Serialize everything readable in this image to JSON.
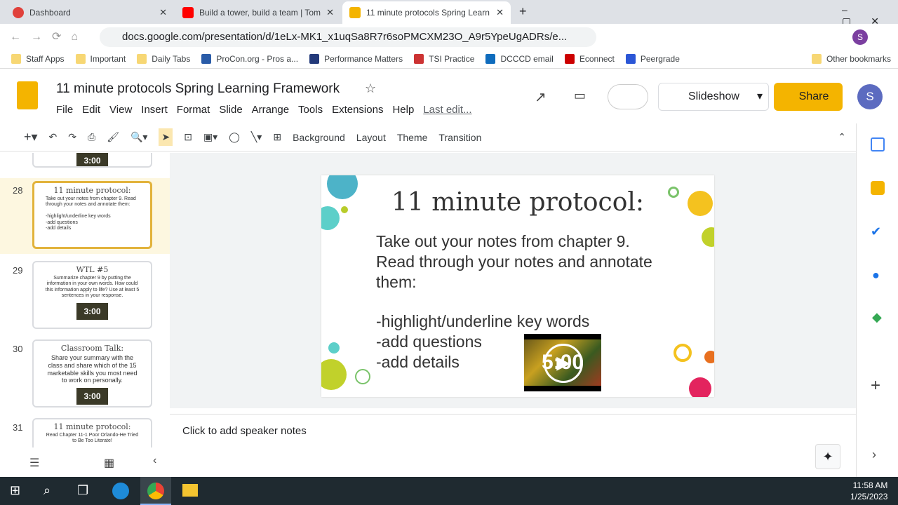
{
  "browser": {
    "tabs": [
      {
        "title": "Dashboard",
        "color": "#e0413b"
      },
      {
        "title": "Build a tower, build a team | Tom",
        "color": "#ff0000"
      },
      {
        "title": "11 minute protocols Spring Learn",
        "color": "#f4b400"
      }
    ],
    "url": "docs.google.com/presentation/d/1eLx-MK1_x1uqSa8R7r6soPMCXM23O_A9r5YpeUgADRs/e...",
    "bookmarks": [
      "Staff Apps",
      "Important",
      "Daily Tabs",
      "ProCon.org - Pros a...",
      "Performance Matters",
      "TSI Practice",
      "DCCCD email",
      "Econnect",
      "Peergrade"
    ],
    "other_bookmarks": "Other bookmarks",
    "profile_initial": "S"
  },
  "app": {
    "title": "11 minute protocols Spring Learning Framework",
    "menu": [
      "File",
      "Edit",
      "View",
      "Insert",
      "Format",
      "Slide",
      "Arrange",
      "Tools",
      "Extensions",
      "Help"
    ],
    "last_edit": "Last edit...",
    "slideshow": "Slideshow",
    "share": "Share",
    "avatar": "S",
    "accent": "#f4b400"
  },
  "toolbar": {
    "background": "Background",
    "layout": "Layout",
    "theme": "Theme",
    "transition": "Transition"
  },
  "filmstrip": [
    {
      "num": "",
      "title": "",
      "body": "",
      "timer": "3:00"
    },
    {
      "num": "28",
      "title": "11 minute protocol:",
      "body": "Take out your notes from chapter 9.  Read through your notes and annotate them:\n\n-highlight/underline key words\n-add questions\n-add details",
      "timer": "5:00",
      "selected": true
    },
    {
      "num": "29",
      "title": "WTL #5",
      "body": "Summarize chapter 9 by putting the information in your own words.  How could this information apply to life? Use at least 5 sentences in your response.",
      "timer": "3:00"
    },
    {
      "num": "30",
      "title": "Classroom Talk:",
      "body": "Share your summary with the class and share which of the 15 marketable skills you most need to work on personally.",
      "timer": "3:00"
    },
    {
      "num": "31",
      "title": "11 minute protocol:",
      "body": "Read Chapter 11-1 Poor Orlando-He Tried to Be Too Literate!",
      "timer": ""
    }
  ],
  "slide": {
    "title": "11 minute protocol:",
    "body": "Take out your notes from chapter 9.  Read through your notes and annotate them:",
    "bullets": [
      "-highlight/underline key words",
      "-add questions",
      "-add details"
    ],
    "timer": "5:00"
  },
  "notes": {
    "placeholder": "Click to add speaker notes"
  },
  "taskbar": {
    "time": "11:58 AM",
    "date": "1/25/2023"
  }
}
